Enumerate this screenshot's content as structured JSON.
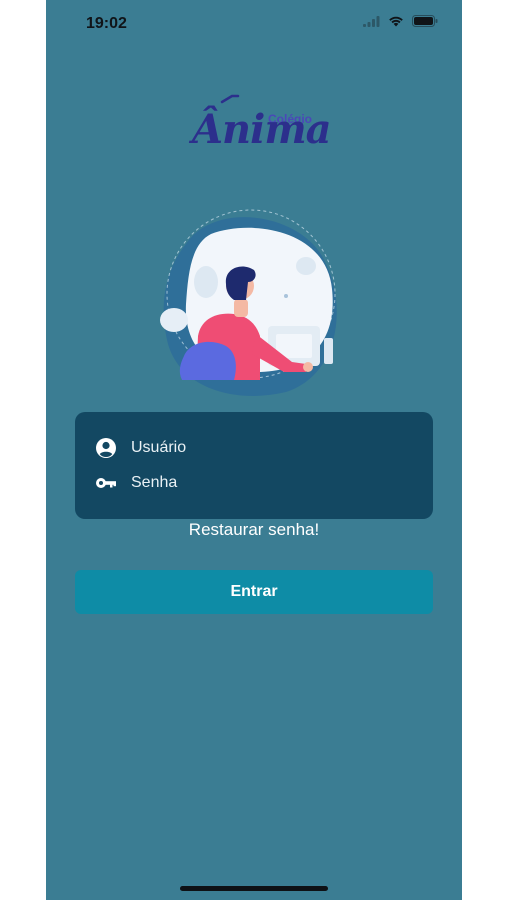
{
  "status_bar": {
    "time": "19:02"
  },
  "logo": {
    "small_text": "Colégio",
    "script_text": "Ânima"
  },
  "login": {
    "username_label": "Usuário",
    "password_label": "Senha",
    "restore_link": "Restaurar senha!",
    "submit_label": "Entrar"
  },
  "colors": {
    "background": "#3b7d93",
    "card": "#134862",
    "button": "#0e8ca6",
    "logo": "#2c2f8c"
  },
  "icons": {
    "user": "account-circle-icon",
    "password": "key-icon",
    "signal": "cellular-signal-icon",
    "wifi": "wifi-icon",
    "battery": "battery-icon"
  }
}
